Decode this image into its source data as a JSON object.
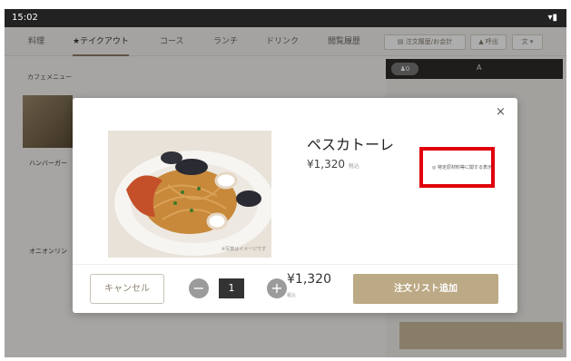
{
  "status_bar": {
    "time": "15:02",
    "icons": "wifi-icon battery-icon"
  },
  "tabs": [
    {
      "label": "料理"
    },
    {
      "label": "★テイクアウト"
    },
    {
      "label": "コース"
    },
    {
      "label": "ランチ"
    },
    {
      "label": "ドリンク"
    },
    {
      "label": "閲覧履歴"
    }
  ],
  "header_buttons": {
    "order_history": "注文履歴/お会計",
    "staff_call": "呼出",
    "language": "文"
  },
  "menu_section": {
    "label": "カフェメニュー"
  },
  "background_tiles": [
    {
      "label": "ハンバーガー"
    },
    {
      "label": "オニオンリン"
    }
  ],
  "right_panel": {
    "count_label": "0",
    "column_label": "A"
  },
  "modal": {
    "close_symbol": "×",
    "product_name": "ペスカトーレ",
    "price": "¥1,320",
    "price_tax": "税込",
    "highlight_note": "特定原材料等に関する表示",
    "cancel_label": "キャンセル",
    "minus_symbol": "−",
    "quantity": "1",
    "plus_symbol": "+",
    "total_price": "¥1,320",
    "total_tax": "税込",
    "add_label": "注文リスト追加",
    "photo_caption": "※写真はイメージです"
  },
  "colors": {
    "accent": "#bca985",
    "highlight_border": "#e0000b",
    "status_bar": "#222222"
  }
}
